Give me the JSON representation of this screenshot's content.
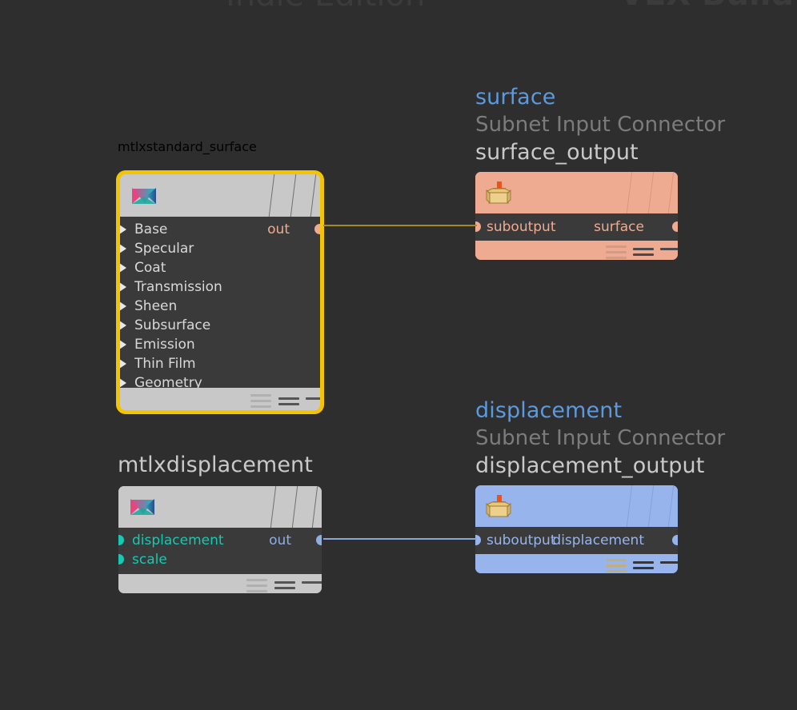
{
  "watermarks": {
    "left": "Indie Edition",
    "right": "VEX Build"
  },
  "colors": {
    "background": "#2e2e2e",
    "node_header": "#c8c8c8",
    "node_body": "#3a3a3a",
    "selection_outline": "#f5c400",
    "surface_accent": "#efab92",
    "displacement_accent": "#97b5ec",
    "input_dot_teal": "#17c8b2",
    "out_text_blue": "#8faee4",
    "out_text_salmon": "#efab92",
    "title_blue": "#5b9ade",
    "title_gray": "#7c7c7c",
    "title_light": "#c9c9c9",
    "surface_wire": "#a08a25",
    "displacement_wire": "#8aa6d8"
  },
  "nodes": {
    "mtlxstandard_surface": {
      "title": "mtlxstandard_surface",
      "icon": "materialx-logo-icon",
      "selected": true,
      "inputs": [
        "Base",
        "Specular",
        "Coat",
        "Transmission",
        "Sheen",
        "Subsurface",
        "Emission",
        "Thin Film",
        "Geometry"
      ],
      "output_label": "out"
    },
    "mtlxdisplacement": {
      "title": "mtlxdisplacement",
      "icon": "materialx-logo-icon",
      "selected": false,
      "inputs": [
        "displacement",
        "scale"
      ],
      "output_label": "out"
    },
    "surface_output": {
      "connector_name": "surface",
      "connector_type": "Subnet Input Connector",
      "title": "surface_output",
      "icon": "subnet-output-box-icon",
      "input_label": "suboutput",
      "output_label": "surface"
    },
    "displacement_output": {
      "connector_name": "displacement",
      "connector_type": "Subnet Input Connector",
      "title": "displacement_output",
      "icon": "subnet-output-box-icon",
      "input_label": "suboutput",
      "output_label": "displacement"
    }
  }
}
